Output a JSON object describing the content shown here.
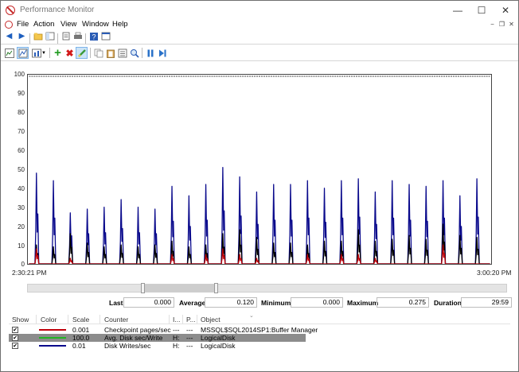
{
  "window": {
    "title": "Performance Monitor"
  },
  "window_controls": {
    "minimize": "—",
    "maximize": "☐",
    "close": "✕"
  },
  "menu": {
    "items": [
      "File",
      "Action",
      "View",
      "Window",
      "Help"
    ]
  },
  "mdi_controls": {
    "minimize": "−",
    "restore": "❐",
    "close": "✕"
  },
  "graph": {
    "y_ticks": [
      "100",
      "90",
      "80",
      "70",
      "60",
      "50",
      "40",
      "30",
      "20",
      "10",
      "0"
    ],
    "start_time": "2:30:21 PM",
    "end_time": "3:00:20 PM",
    "colors": {
      "writes": "#0a0a8c",
      "checkpoint": "#c0000a",
      "avg_disk": "#000000"
    }
  },
  "chart_data": {
    "type": "line",
    "ylim": [
      0,
      100
    ],
    "x_start": "2:30:21 PM",
    "x_end": "3:00:20 PM",
    "series": [
      {
        "name": "Disk Writes/sec",
        "color": "#0a0a8c",
        "spikes": [
          48,
          44,
          27,
          29,
          30,
          34,
          30,
          29,
          41,
          36,
          42,
          51,
          46,
          38,
          42,
          42,
          44,
          40,
          44,
          45,
          38,
          44,
          42,
          41,
          44,
          36,
          45
        ]
      },
      {
        "name": "Avg. Disk sec/Write",
        "color": "#000000",
        "spikes": [
          10,
          9,
          16,
          11,
          9,
          10,
          9,
          10,
          12,
          9,
          10,
          16,
          18,
          14,
          11,
          11,
          10,
          12,
          12,
          18,
          12,
          13,
          15,
          13,
          21,
          15,
          14
        ]
      },
      {
        "name": "Checkpoint pages/sec",
        "color": "#c0000a",
        "spikes": [
          8,
          0,
          3,
          0,
          0,
          0,
          0,
          0,
          5,
          0,
          5,
          8,
          5,
          3,
          0,
          0,
          5,
          0,
          5,
          5,
          3,
          0,
          0,
          0,
          10,
          0,
          0
        ]
      }
    ]
  },
  "stats": {
    "last_label": "Last",
    "last_value": "0.000",
    "average_label": "Average",
    "average_value": "0.120",
    "minimum_label": "Minimum",
    "minimum_value": "0.000",
    "maximum_label": "Maximum",
    "maximum_value": "0.275",
    "duration_label": "Duration",
    "duration_value": "29:59"
  },
  "legend": {
    "headers": {
      "show": "Show",
      "color": "Color",
      "scale": "Scale",
      "counter": "Counter",
      "instance": "I...",
      "parent": "P...",
      "object": "Object"
    },
    "rows": [
      {
        "checked": "✔",
        "color": "#c0000a",
        "scale": "0.001",
        "counter": "Checkpoint pages/sec",
        "instance": "---",
        "parent": "---",
        "object": "MSSQL$SQL2014SP1:Buffer Manager"
      },
      {
        "checked": "✔",
        "color": "#22b422",
        "scale": "100.0",
        "counter": "Avg. Disk sec/Write",
        "instance": "H:",
        "parent": "---",
        "object": "LogicalDisk"
      },
      {
        "checked": "✔",
        "color": "#0a0a8c",
        "scale": "0.01",
        "counter": "Disk Writes/sec",
        "instance": "H:",
        "parent": "---",
        "object": "LogicalDisk"
      }
    ]
  }
}
